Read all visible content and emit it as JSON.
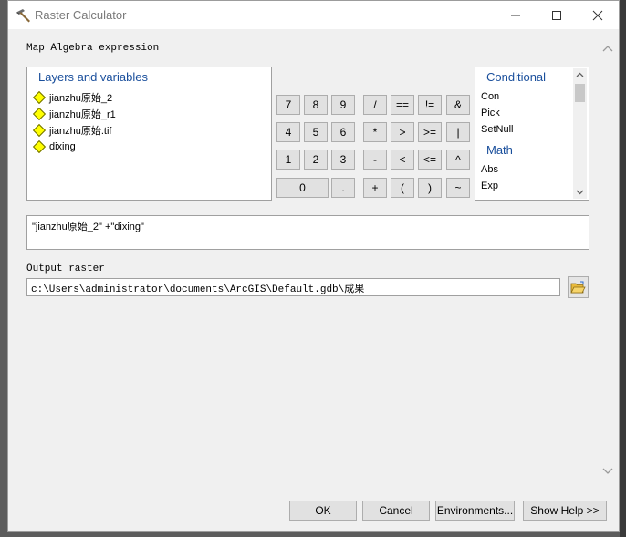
{
  "window": {
    "title": "Raster Calculator"
  },
  "map_algebra": {
    "label": "Map Algebra expression"
  },
  "layers": {
    "title": "Layers and variables",
    "items": [
      "jianzhu原始_2",
      "jianzhu原始_r1",
      "jianzhu原始.tif",
      "dixing"
    ]
  },
  "keypad": {
    "row1": [
      "7",
      "8",
      "9",
      "/",
      "==",
      "!=",
      "&"
    ],
    "row2": [
      "4",
      "5",
      "6",
      "*",
      ">",
      ">=",
      "|"
    ],
    "row3": [
      "1",
      "2",
      "3",
      "-",
      "<",
      "<=",
      "^"
    ],
    "row4": [
      "0",
      ".",
      "+",
      "(",
      ")",
      "~"
    ]
  },
  "functions": {
    "conditional_title": "Conditional",
    "conditional_items": [
      "Con",
      "Pick",
      "SetNull"
    ],
    "math_title": "Math",
    "math_items": [
      "Abs",
      "Exp"
    ]
  },
  "expression": {
    "value": "\"jianzhu原始_2\" +\"dixing\""
  },
  "output": {
    "label": "Output raster",
    "value": "c:\\Users\\administrator\\documents\\ArcGIS\\Default.gdb\\成果"
  },
  "buttons": {
    "ok": "OK",
    "cancel": "Cancel",
    "environments": "Environments...",
    "show_help": "Show Help >>"
  },
  "icons": {
    "app": "hammer-icon",
    "minimize": "minimize-icon",
    "maximize": "maximize-icon",
    "close": "close-icon",
    "folder": "open-folder-icon"
  },
  "colors": {
    "group_title": "#1a4f9c",
    "layer_symbol": "#ffff00"
  }
}
